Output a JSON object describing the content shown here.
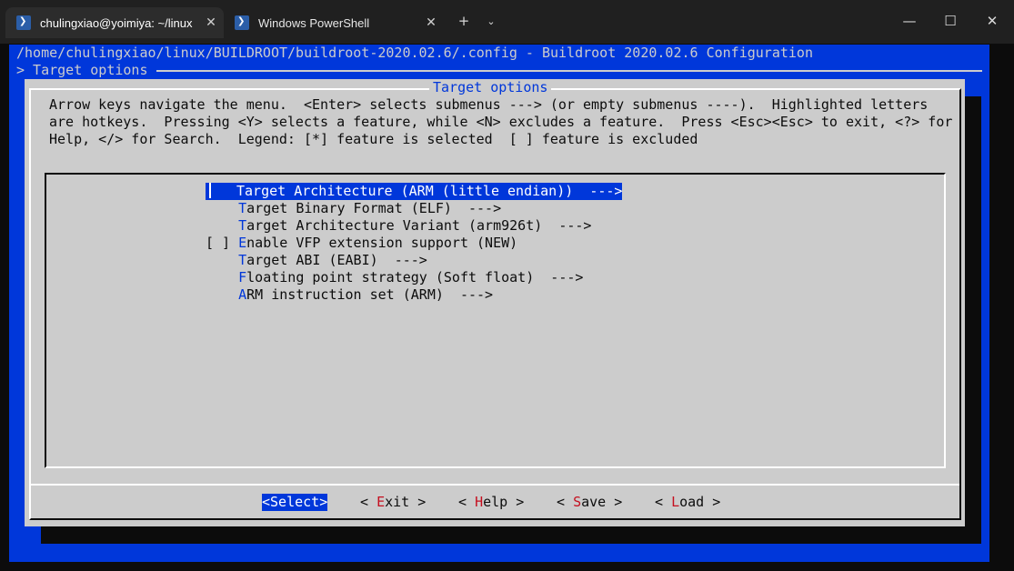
{
  "tabs": [
    {
      "title": "chulingxiao@yoimiya: ~/linux",
      "icon": "powershell-icon",
      "active": true
    },
    {
      "title": "Windows PowerShell",
      "icon": "powershell-icon",
      "active": false
    }
  ],
  "titlebar": {
    "new_tab": "+",
    "dropdown": "⌄",
    "minimize": "—",
    "maximize": "☐",
    "close": "✕"
  },
  "terminal": {
    "path_line": "/home/chulingxiao/linux/BUILDROOT/buildroot-2020.02.6/.config - Buildroot 2020.02.6 Configuration",
    "breadcrumb": "> Target options"
  },
  "dialog": {
    "title": "Target options",
    "help_lines": [
      "Arrow keys navigate the menu.  <Enter> selects submenus ---> (or empty submenus ----).  Highlighted letters",
      "are hotkeys.  Pressing <Y> selects a feature, while <N> excludes a feature.  Press <Esc><Esc> to exit, <?> for",
      "Help, </> for Search.  Legend: [*] feature is selected  [ ] feature is excluded"
    ],
    "menu": [
      {
        "prefix": "   ",
        "hotkey": "T",
        "rest": "arget Architecture (ARM (little endian))  --->",
        "selected": true
      },
      {
        "prefix": "    ",
        "hotkey": "T",
        "rest": "arget Binary Format (ELF)  --->",
        "selected": false
      },
      {
        "prefix": "    ",
        "hotkey": "T",
        "rest": "arget Architecture Variant (arm926t)  --->",
        "selected": false
      },
      {
        "prefix": "[ ] ",
        "hotkey": "E",
        "rest": "nable VFP extension support (NEW)",
        "selected": false
      },
      {
        "prefix": "    ",
        "hotkey": "T",
        "rest": "arget ABI (EABI)  --->",
        "selected": false
      },
      {
        "prefix": "    ",
        "hotkey": "F",
        "rest": "loating point strategy (Soft float)  --->",
        "selected": false
      },
      {
        "prefix": "    ",
        "hotkey": "A",
        "rest": "RM instruction set (ARM)  --->",
        "selected": false
      }
    ],
    "buttons": {
      "select": "<Select>",
      "exit": {
        "pre": "< ",
        "hot": "E",
        "rest": "xit >"
      },
      "help": {
        "pre": "< ",
        "hot": "H",
        "rest": "elp >"
      },
      "save": {
        "pre": "< ",
        "hot": "S",
        "rest": "ave >"
      },
      "load": {
        "pre": "< ",
        "hot": "L",
        "rest": "oad >"
      }
    }
  },
  "colors": {
    "terminal_blue": "#0037da",
    "dialog_gray": "#cccccc",
    "hotkey_red": "#c50f1f",
    "titlebar": "#202020"
  }
}
